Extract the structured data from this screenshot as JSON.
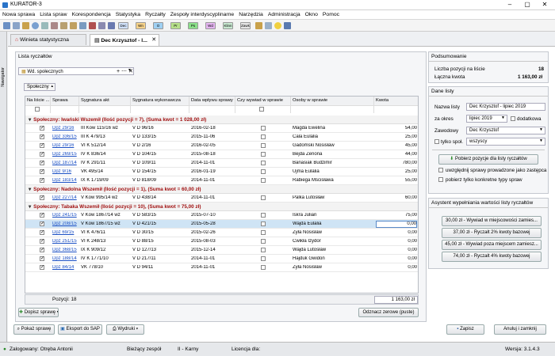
{
  "window": {
    "title": "KURATOR-3"
  },
  "menu": [
    "Nowa sprawa",
    "Lista spraw",
    "Korespondencja",
    "Statystyka",
    "Ryczałty",
    "Zespoły interdyscyplinarne",
    "Narzędzia",
    "Administracja",
    "Okno",
    "Pomoc"
  ],
  "toolbar": {
    "chips": [
      "Dec",
      "Wn",
      "O",
      "Pr",
      "Ps",
      "Wd",
      "Klinn",
      "Zawk"
    ]
  },
  "navigator": {
    "label": "Nawigator"
  },
  "tabs": [
    {
      "label": "Winieta statystyczna"
    },
    {
      "label": "Dec Krzysztof - l..."
    }
  ],
  "list": {
    "title": "Lista ryczałtów",
    "filter": "Wd. społecznych",
    "groupby": "Społeczny",
    "columns": [
      "Na liście ...",
      "Sprawa",
      "Sygnatura akt",
      "Sygnatura wykonawcza",
      "Data wpływu sprawy",
      "Czy wywiad w sprawie",
      "Osoby w sprawie",
      "Kwota"
    ],
    "groups": [
      {
        "header": "Społeczny: Iwański Wszemił (Ilość pozycji = 7), (Suma kwot = 1 028,00 zł)",
        "rows": [
          [
            "Dpz 29/16",
            "III Kow 115/16 wz",
            "V D 96/16",
            "2016-02-18",
            "Magda Ewelina",
            "54,00"
          ],
          [
            "Dpz 336/15",
            "III K 479/13",
            "V D 133/15",
            "2015-11-06",
            "Cala Eulalia",
            "25,00"
          ],
          [
            "Dpz 29/16",
            "VI K 512/14",
            "V D 2/16",
            "2016-02-05",
            "Gadomski Nosisław",
            "45,00"
          ],
          [
            "Dpz 269/15",
            "IV K 836/14",
            "V D 104/15",
            "2015-08-18",
            "Bejda Zenona",
            "44,00"
          ],
          [
            "Dpz 187/14",
            "IV K 291/11",
            "V D 109/11",
            "2014-11-01",
            "Banasiak Budzimir",
            "780,00"
          ],
          [
            "Dpz 9/16",
            "VK 495/14",
            "V D 154/15",
            "2016-01-19",
            "Ujma Eulalia",
            "25,00"
          ],
          [
            "Dpz 183/14",
            "IX K 1719/09",
            "V D 818/09",
            "2014-11-01",
            "Rabiega Mścisława",
            "55,00"
          ]
        ]
      },
      {
        "header": "Społeczny: Nadolna Wszemił (Ilość pozycji = 1), (Suma kwot = 60,00 zł)",
        "rows": [
          [
            "Dpz 227/14",
            "V Kow 995/14 wz",
            "V D 438/14",
            "2014-11-01",
            "Palka Lutosław",
            "60,00"
          ]
        ]
      },
      {
        "header": "Społeczny: Tabaka Wszemił (Ilość pozycji = 10), (Suma kwot = 75,00 zł)",
        "rows": [
          [
            "Dpz 241/15",
            "V Kow 1867/14 wz",
            "V D 583/15",
            "2015-07-10",
            "Iskra Julian",
            "75,00"
          ],
          [
            "Dpz 208/15",
            "V Kow 1867/15 wz",
            "V D 421/15",
            "2015-05-28",
            "Wajda Eulalia",
            "0,00"
          ],
          [
            "Dpz 69/15",
            "VI K 476/11",
            "V D 30/15",
            "2015-02-26",
            "Żyła Nosisław",
            "0,00"
          ],
          [
            "Dpz 251/15",
            "VI K 248/13",
            "V D 88/15",
            "2015-08-03",
            "Ćwikła Izydor",
            "0,00"
          ],
          [
            "Dpz 368/15",
            "IX K 909/12",
            "V D 127/13",
            "2015-12-14",
            "Wajda Lutosław",
            "0,00"
          ],
          [
            "Dpz 188/14",
            "IV K 1771/10",
            "V D 217/11",
            "2014-11-01",
            "Hajduk Gwidon",
            "0,00"
          ],
          [
            "Dpz 84/14",
            "VK 778/10",
            "V D 94/11",
            "2014-11-01",
            "Żyła Nosisław",
            "0,00"
          ]
        ]
      }
    ],
    "footer": {
      "count": "Pozycji: 18",
      "sum": "1 163,00 zł"
    },
    "add_button": "Dopisz sprawę",
    "zero_button": "Odznacz zerowe (puste)"
  },
  "summary": {
    "title": "Podsumowanie",
    "count_label": "Liczba pozycji na liście",
    "count": "18",
    "total_label": "Łączna kwota",
    "total": "1 163,00 zł"
  },
  "details": {
    "title": "Dane listy",
    "name_label": "Nazwa listy",
    "name": "Dec Krzysztof - lipiec 2019",
    "period_label": "za okres",
    "period": "lipiec 2019",
    "extra": "dodatkowa",
    "prof_label": "Zawodowy",
    "prof": "Dec Krzysztof",
    "social_label": "tylko społ.",
    "social": "wszyscy",
    "fetch_button": "Pobierz pozycje dla listy ryczałtów",
    "opt1": "uwzględnij sprawy prowadzone jako zastępca",
    "opt2": "pobierz tylko konkretne typy spraw"
  },
  "assistant": {
    "title": "Asystent wypełniania wartości listy ryczałtów",
    "buttons": [
      "30,00 zł - Wywiad w miejscowości zamies...",
      "37,00 zł - Ryczałt 2% kwoty bazowej",
      "45,00 zł - Wywiad poza miejscem zamiesz...",
      "74,00 zł - Ryczałt 4% kwoty bazowej"
    ]
  },
  "bottom": {
    "show": "Pokaż sprawę",
    "export": "Eksport do SAP",
    "print": "Wydruki",
    "save": "Zapisz",
    "cancel": "Anuluj i zamknij"
  },
  "status": {
    "user": "Zalogowany: Otręba Antonii",
    "team": "Bieżący zespół",
    "team_val": "II - Karny",
    "license": "Licencja dla:",
    "version": "Wersja: 3.1.4.3"
  }
}
